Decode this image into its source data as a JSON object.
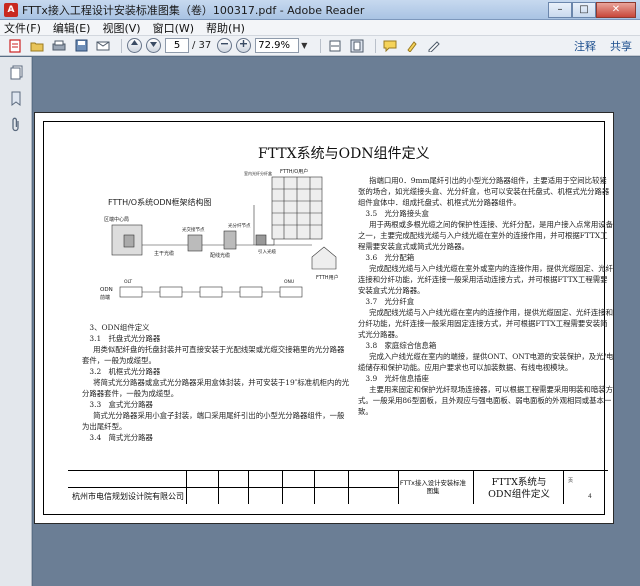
{
  "window": {
    "title": "FTTx接入工程设计安装标准图集（卷）100317.pdf - Adobe Reader",
    "app_badge": "A",
    "min": "–",
    "max": "□",
    "close": "✕"
  },
  "menu": [
    "文件(F)",
    "编辑(E)",
    "视图(V)",
    "窗口(W)",
    "帮助(H)"
  ],
  "toolbar": {
    "page_current": "5",
    "page_total": "/ 37",
    "zoom": "72.9%",
    "comment_label": "注释",
    "share_label": "共享"
  },
  "document": {
    "title": "FTTX系统与ODN组件定义",
    "diagram_title": "FTTH/O系统ODN框架结构图",
    "diagram_labels": {
      "central_office": "区端中心局",
      "main_cable": "主干光缆",
      "splice_node": "光交接节点",
      "distribution_cable": "配线光缆",
      "split_node": "光分纤节点",
      "drop_cable": "引入光缆",
      "fttb_user": "FTTH/O用户",
      "ftth_user": "FTTH用户",
      "odn_a": "ODN",
      "odn_b": "前端",
      "building_box": "室内光纤分纤盒",
      "olt": "OLT",
      "onu": "ONU"
    },
    "left_paragraphs": [
      {
        "style": "head",
        "text": "3、ODN组件定义"
      },
      {
        "style": "head",
        "text": "3.1　托盘式光分路器"
      },
      {
        "style": "para",
        "text": "用类似配纤盘的托盘封装并可直接安装于光配线架或光缆交接箱里的光分路器套件，一般为成缆型。"
      },
      {
        "style": "head",
        "text": "3.2　机框式光分路器"
      },
      {
        "style": "para",
        "text": "将简式光分路器或盒式光分路器采用盒体封装，并可安装于19″标准机柜内的光分路器套件，一般为成缆型。"
      },
      {
        "style": "head",
        "text": "3.3　盒式光分路器"
      },
      {
        "style": "para",
        "text": "简式光分路器采用小盒子封装，端口采用尾纤引出的小型光分路器组件，一般为出尾纤型。"
      },
      {
        "style": "head",
        "text": "3.4　简式光分路器"
      }
    ],
    "right_paragraphs": [
      {
        "style": "para",
        "text": "指端口用0．9mm尾纤引出的小型光分路器组件，主要适用于空间比较紧张的场合，如光缆接头盒、光分纤盒，也可以安装在托盘式、机框式光分路器组件盒体中．组成托盘式、机框式光分路器组件。"
      },
      {
        "style": "head",
        "text": "3.5　光分路接头盒"
      },
      {
        "style": "para",
        "text": "用于两根或多根光缆之间的保护性连接、光纤分配，是用户接入点常用设备之一，主要完成配线光缆与入户线光缆在室外的连接作用，并可根据FTTX工程需要安装盒式或简式光分路器。"
      },
      {
        "style": "head",
        "text": "3.6　光分配箱"
      },
      {
        "style": "para",
        "text": "完成配线光缆与入户线光缆在室外或室内的连接作用，提供光缆固定、光纤连接和分纤功能，光纤连接一般采用活动连接方式，并可根据FTTX工程需要安装盒式光分路器。"
      },
      {
        "style": "head",
        "text": "3.7　光分纤盒"
      },
      {
        "style": "para",
        "text": "完成配线光缆与入户线光缆在室内的连接作用，提供光缆固定、光纤连接和分纤功能，光纤连接一般采用固定连接方式，并可根据FTTX工程需要安装简式光分路器。"
      },
      {
        "style": "head",
        "text": "3.8　家庭综合信息箱"
      },
      {
        "style": "para",
        "text": "完成入户线光缆在室内的端接，提供ONT、ONT电源的安装保护，及光/电缆储存和保护功能。应用户要求也可以加装数据、有线电视模块。"
      },
      {
        "style": "head",
        "text": "3.9　光纤信息插座"
      },
      {
        "style": "para",
        "text": "主要用来固定和保护光纤现场连接器，可以根据工程需要采用明装和暗装方式。一般采用86型面板，且外观应与强电面板、弱电面板的外观相同或基本一致。"
      }
    ],
    "title_block": {
      "company": "杭州市电信规划设计院有限公司",
      "atlas": "FTTx接入设计安装标准图集",
      "sheet_title": "FTTX系统与ODN组件定义",
      "page_no_label": "页",
      "page_no": "4"
    }
  },
  "icons": {
    "sidebar": [
      "pages-icon",
      "bookmark-icon",
      "attachment-icon"
    ]
  }
}
